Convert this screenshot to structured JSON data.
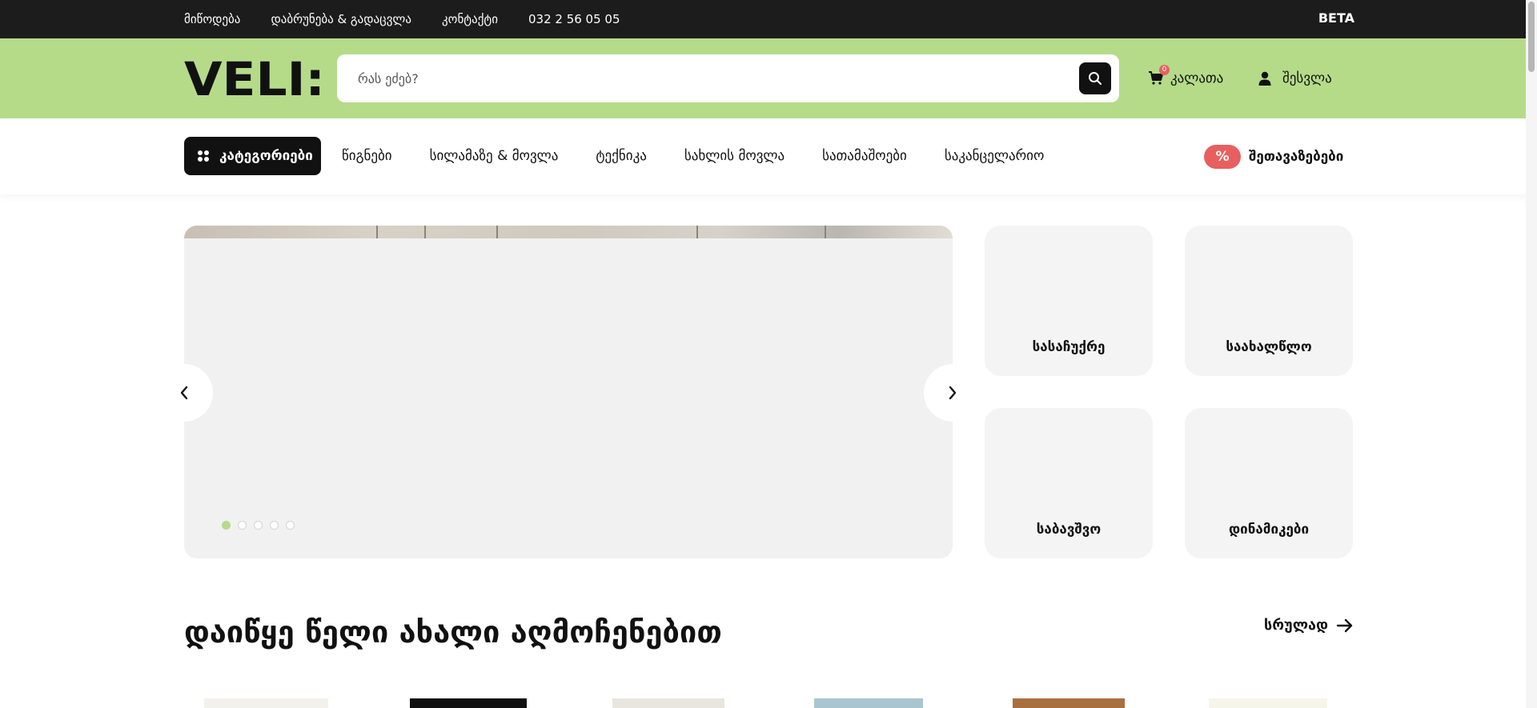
{
  "topbar": {
    "links": [
      "მიწოდება",
      "დაბრუნება & გადაცვლა",
      "კონტაქტი",
      "032 2 56 05 05"
    ],
    "beta": "BETA"
  },
  "header": {
    "logo_text": "VELI:",
    "search_placeholder": "რას ეძებ?",
    "search_icon": "search-icon",
    "cart_label": "კალათა",
    "cart_count": "0",
    "login_label": "შესვლა"
  },
  "nav": {
    "categories_label": "კატეგორიები",
    "links": [
      "წიგნები",
      "სილამაზე & მოვლა",
      "ტექნიკა",
      "სახლის მოვლა",
      "სათამაშოები",
      "საკანცელარიო"
    ],
    "deals_badge": "%",
    "deals_label": "შეთავაზებები"
  },
  "hero": {
    "slide_count": 5,
    "active_slide": 1
  },
  "tiles": [
    "სასაჩუქრე",
    "საახალწლო",
    "საბავშვო",
    "დინამიკები"
  ],
  "section": {
    "title": "დაიწყე წელი ახალი აღმოჩენებით",
    "see_all": "სრულად"
  },
  "colors": {
    "topbar": "#1c1c1c",
    "header": "#b5db89",
    "accent_red": "#e85f5f",
    "tile_bg": "#f4f4f5"
  }
}
